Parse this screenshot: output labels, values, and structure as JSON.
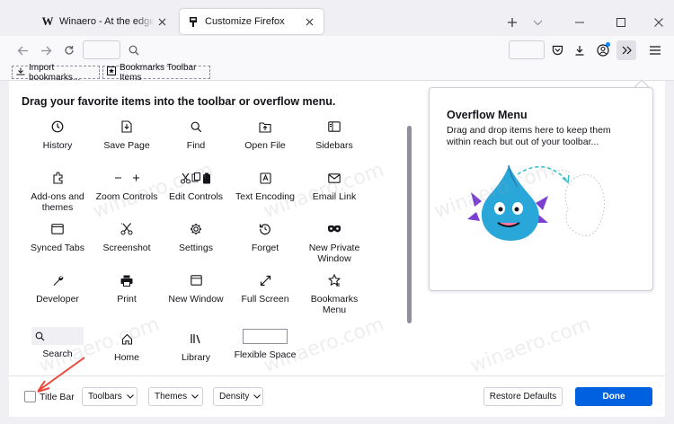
{
  "tabs": [
    {
      "title": "Winaero - At the edge of tweaking",
      "icon": "winaero-favicon"
    },
    {
      "title": "Customize Firefox",
      "icon": "customize-icon",
      "active": true
    }
  ],
  "bookmarks_bar": {
    "items": [
      {
        "label": "Import bookmarks...",
        "icon": "import-icon"
      },
      {
        "label": "Bookmarks Toolbar Items",
        "icon": "bookmarks-toolbar-icon"
      }
    ]
  },
  "customize": {
    "heading": "Drag your favorite items into the toolbar or overflow menu.",
    "items": [
      {
        "label": "History",
        "icon": "history-icon"
      },
      {
        "label": "Save Page",
        "icon": "save-page-icon"
      },
      {
        "label": "Find",
        "icon": "find-icon"
      },
      {
        "label": "Open File",
        "icon": "open-file-icon"
      },
      {
        "label": "Sidebars",
        "icon": "sidebars-icon"
      },
      {
        "label": "Add-ons and themes",
        "icon": "addons-icon"
      },
      {
        "label": "Zoom Controls",
        "icon": "zoom-controls-icon"
      },
      {
        "label": "Edit Controls",
        "icon": "edit-controls-icon"
      },
      {
        "label": "Text Encoding",
        "icon": "text-encoding-icon"
      },
      {
        "label": "Email Link",
        "icon": "email-link-icon"
      },
      {
        "label": "Synced Tabs",
        "icon": "synced-tabs-icon"
      },
      {
        "label": "Screenshot",
        "icon": "screenshot-icon"
      },
      {
        "label": "Settings",
        "icon": "settings-icon"
      },
      {
        "label": "Forget",
        "icon": "forget-icon"
      },
      {
        "label": "New Private Window",
        "icon": "private-window-icon"
      },
      {
        "label": "Developer",
        "icon": "developer-icon"
      },
      {
        "label": "Print",
        "icon": "print-icon"
      },
      {
        "label": "New Window",
        "icon": "new-window-icon"
      },
      {
        "label": "Full Screen",
        "icon": "full-screen-icon"
      },
      {
        "label": "Bookmarks Menu",
        "icon": "bookmarks-menu-icon"
      },
      {
        "label": "Search",
        "icon": "search-icon"
      },
      {
        "label": "Home",
        "icon": "home-icon"
      },
      {
        "label": "Library",
        "icon": "library-icon"
      },
      {
        "label": "Flexible Space",
        "icon": "flexible-space-icon"
      }
    ]
  },
  "overflow_panel": {
    "title": "Overflow Menu",
    "description": "Drag and drop items here to keep them within reach but out of your toolbar..."
  },
  "footer": {
    "title_bar_label": "Title Bar",
    "title_bar_checked": false,
    "toolbars_label": "Toolbars",
    "themes_label": "Themes",
    "density_label": "Density",
    "restore_label": "Restore Defaults",
    "done_label": "Done"
  },
  "watermark_text": "winaero.com",
  "colors": {
    "accent": "#0061e0",
    "arrow": "#e8473a",
    "mascot": "#2aa7d9",
    "horns": "#7b3fd1"
  }
}
